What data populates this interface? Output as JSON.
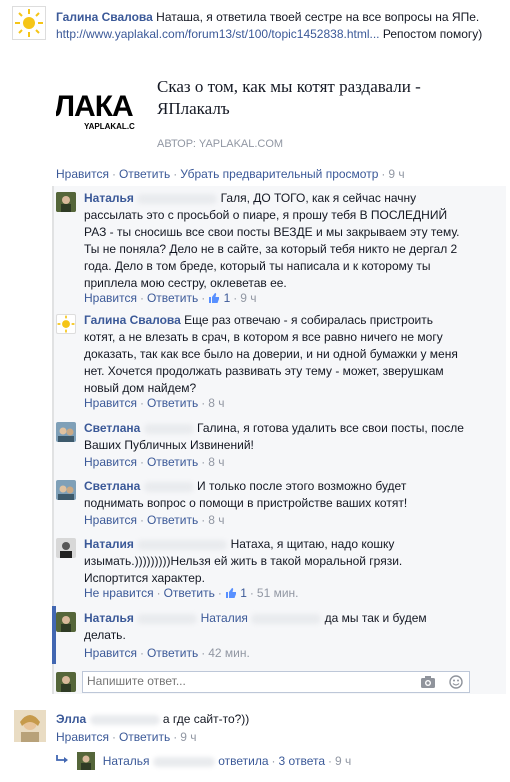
{
  "post": {
    "author": "Галина Свалова",
    "text": "Наташа, я ответила твоей сестре на все вопросы на ЯПе.",
    "link_text": "http://www.yaplakal.com/forum13/st/100/topic1452838.html...",
    "text_after": "Репостом помогу)",
    "preview": {
      "logo_main": "ЛАКА",
      "logo_sub": "YAPLAKAL.C",
      "title": "Сказ о том, как мы котят раздавали - ЯПлакалъ",
      "source": "АВТОР: YAPLAKAL.COM"
    },
    "actions": {
      "like": "Нравится",
      "reply": "Ответить",
      "remove_preview": "Убрать предварительный просмотр",
      "time": "9 ч"
    }
  },
  "replies": [
    {
      "author": "Наталья",
      "text": "Галя, ДО ТОГО, как я сейчас начну рассылать это с просьбой о пиаре, я прошу тебя В ПОСЛЕДНИЙ РАЗ - ты сносишь все свои посты ВЕЗДЕ и мы закрываем эту тему. Ты не поняла? Дело не в сайте, за который тебя никто не дергал 2 года. Дело в том бреде, который ты написала и к которому ты приплела мою сестру, оклеветав ее.",
      "like": "Нравится",
      "reply": "Ответить",
      "likes": "1",
      "time": "9 ч"
    },
    {
      "author": "Галина Свалова",
      "text": "Еще раз отвечаю - я собиралась пристроить котят, а не влезать в срач, в котором я все равно ничего не могу доказать, так как все было на доверии, и ни одной бумажки у меня нет. Хочется продолжать развивать эту тему - может, зверушкам новый дом найдем?",
      "like": "Нравится",
      "reply": "Ответить",
      "time": "8 ч"
    },
    {
      "author": "Светлана",
      "text": "Галина, я готова удалить все свои посты, после Ваших Публичных Извинений!",
      "like": "Нравится",
      "reply": "Ответить",
      "time": "8 ч"
    },
    {
      "author": "Светлана",
      "text": "И только после этого возможно будет поднимать вопрос о помощи в пристройстве ваших котят!",
      "like": "Нравится",
      "reply": "Ответить",
      "time": "8 ч"
    },
    {
      "author": "Наталия",
      "text": "Натаха, я щитаю, надо кошку изымать.)))))))))Нельзя ей жить в такой моральной грязи. Испортится характер.",
      "like": "Не нравится",
      "reply": "Ответить",
      "likes": "1",
      "time": "51 мин."
    },
    {
      "author": "Наталья",
      "mention": "Наталия",
      "text": "да мы так и будем делать.",
      "like": "Нравится",
      "reply": "Ответить",
      "time": "42 мин."
    }
  ],
  "reply_input": {
    "placeholder": "Напишите ответ..."
  },
  "comment2": {
    "author": "Элла",
    "text": "а где сайт-то?))",
    "like": "Нравится",
    "reply": "Ответить",
    "time": "9 ч",
    "summary_author": "Наталья",
    "summary_text": "ответила",
    "summary_count": "3 ответа",
    "summary_time": "9 ч"
  }
}
